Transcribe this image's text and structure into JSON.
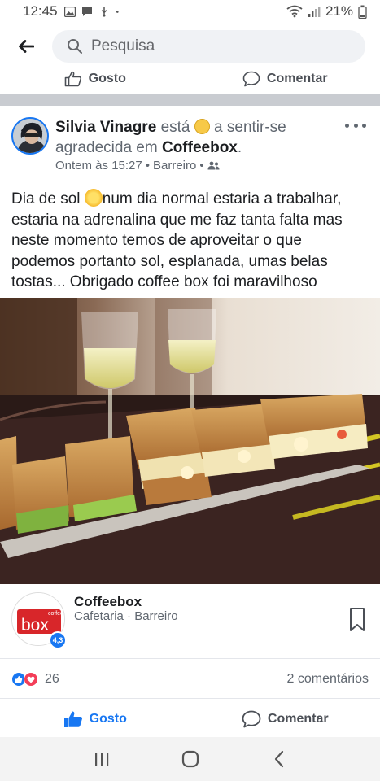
{
  "status_bar": {
    "time": "12:45",
    "battery": "21%",
    "icons": [
      "gallery-icon",
      "message-icon",
      "usb-icon",
      "dot-icon",
      "wifi-icon",
      "signal-icon",
      "battery-icon"
    ]
  },
  "search": {
    "placeholder": "Pesquisa"
  },
  "previous_post": {
    "like_label": "Gosto",
    "comment_label": "Comentar"
  },
  "post": {
    "author": "Silvia Vinagre",
    "feeling_prefix": "está",
    "feeling_text": "a sentir-se agradecida em",
    "location": "Coffeebox",
    "location_suffix": ".",
    "time": "Ontem às 15:27",
    "separator": "•",
    "place": "Barreiro",
    "privacy_icon": "friends-icon",
    "text_part1": "Dia de sol ",
    "text_part2": "num dia normal estaria a trabalhar, estaria na adrenalina que me faz tanta falta mas neste momento temos de aproveitar o que podemos portanto sol, esplanada, umas belas tostas... Obrigado coffee box foi maravilhoso"
  },
  "place_card": {
    "name": "Coffeebox",
    "category": "Cafetaria · Barreiro",
    "rating": "4,3",
    "logo_small_text": "coffee",
    "logo_main_text": "box"
  },
  "reactions": {
    "count": "26",
    "comments": "2 comentários"
  },
  "actions": {
    "like_label": "Gosto",
    "comment_label": "Comentar"
  },
  "colors": {
    "accent": "#1877f2",
    "love": "#f33e58",
    "band": "#c9ccd1"
  }
}
